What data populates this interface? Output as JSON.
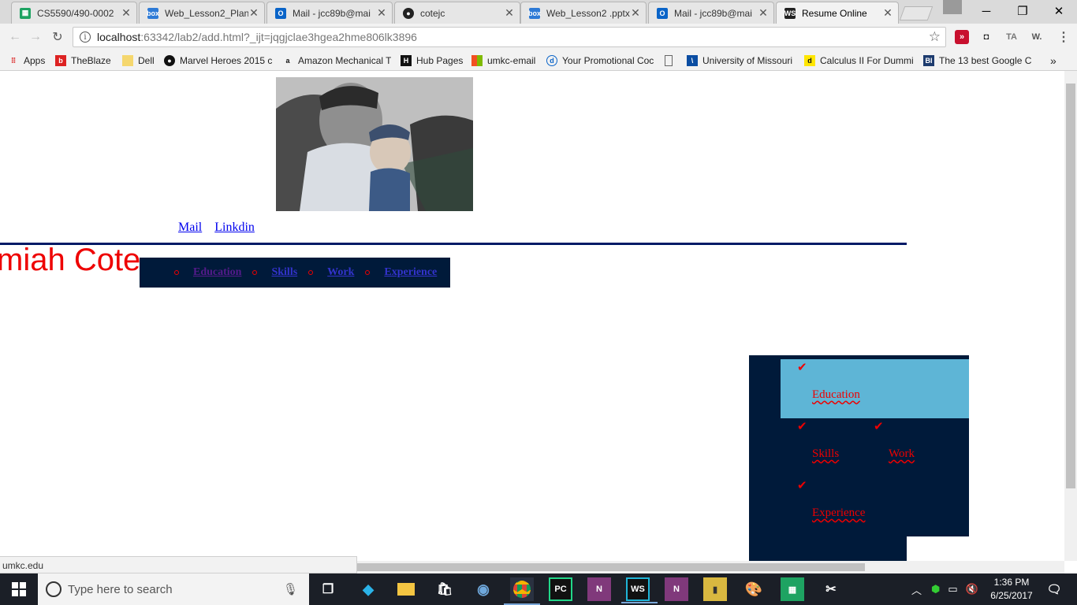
{
  "browser": {
    "tabs": [
      {
        "title": "CS5590/490-0002",
        "icon": "sheets-icon",
        "color": "#1ea362"
      },
      {
        "title": "Web_Lesson2_Plan",
        "icon": "box-icon",
        "color": "#2d7ad6"
      },
      {
        "title": "Mail - jcc89b@mai",
        "icon": "outlook-icon",
        "color": "#0a64c8"
      },
      {
        "title": "cotejc",
        "icon": "github-icon",
        "color": "#222222"
      },
      {
        "title": "Web_Lesson2 .pptx",
        "icon": "box-icon",
        "color": "#2d7ad6"
      },
      {
        "title": "Mail - jcc89b@mai",
        "icon": "outlook-icon",
        "color": "#0a64c8"
      },
      {
        "title": "Resume Online",
        "icon": "webstorm-icon",
        "color": "#222222",
        "active": true
      }
    ],
    "address": {
      "host": "localhost",
      "path": ":63342/lab2/add.html?_ijt=jqgjclae3hgea2hme806lk3896"
    },
    "bookmarks": [
      {
        "label": "Apps",
        "icon": "apps-grid-icon"
      },
      {
        "label": "TheBlaze",
        "icon": "blaze-icon"
      },
      {
        "label": "Dell",
        "icon": "folder-icon"
      },
      {
        "label": "Marvel Heroes 2015 c",
        "icon": "steam-icon"
      },
      {
        "label": "Amazon Mechanical T",
        "icon": "amazon-icon"
      },
      {
        "label": "Hub Pages",
        "icon": "hubpages-icon"
      },
      {
        "label": "umkc-email",
        "icon": "microsoft-icon"
      },
      {
        "label": "Your Promotional Coc",
        "icon": "dell-icon"
      },
      {
        "label": "",
        "icon": "page-icon"
      },
      {
        "label": "University of Missouri",
        "icon": "umkc-icon"
      },
      {
        "label": "Calculus II For Dummi",
        "icon": "dummies-icon"
      },
      {
        "label": "The 13 best Google C",
        "icon": "bi-icon"
      }
    ],
    "status_url": "umkc.edu"
  },
  "page": {
    "links": [
      {
        "label": "Mail"
      },
      {
        "label": "Linkdin"
      }
    ],
    "name": "miah Cote",
    "top_nav": [
      {
        "label": "Education",
        "visited": true
      },
      {
        "label": "Skills"
      },
      {
        "label": "Work"
      },
      {
        "label": "Experience"
      }
    ],
    "side_nav": [
      {
        "label": "Education",
        "active": true
      },
      {
        "label": "Skills"
      },
      {
        "label": "Work"
      },
      {
        "label": "Experience"
      }
    ]
  },
  "taskbar": {
    "search_placeholder": "Type here to search",
    "time": "1:36 PM",
    "date": "6/25/2017"
  }
}
